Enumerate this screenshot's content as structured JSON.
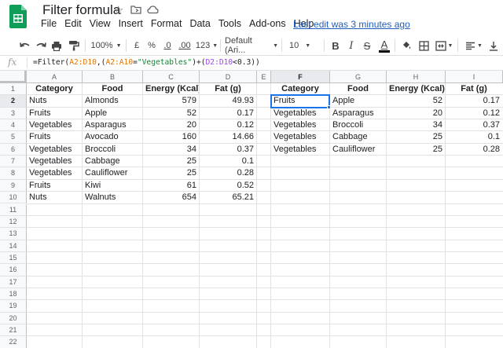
{
  "title": "Filter formula",
  "menu": [
    "File",
    "Edit",
    "View",
    "Insert",
    "Format",
    "Data",
    "Tools",
    "Add-ons",
    "Help"
  ],
  "last_edit": "Last edit was 3 minutes ago",
  "toolbar": {
    "zoom": "100%",
    "currency": "£",
    "percent": "%",
    "dec_less": ".0",
    "dec_more": ".00",
    "more_formats": "123",
    "font": "Default (Ari...",
    "font_size": "10",
    "bold": "B",
    "italic": "I",
    "strike": "S",
    "text_color": "A"
  },
  "formula_bar": {
    "fx": "fx",
    "parts": [
      {
        "text": "=Filter(",
        "cls": ""
      },
      {
        "text": "A2:D10",
        "cls": "f-ref1"
      },
      {
        "text": ",(",
        "cls": ""
      },
      {
        "text": "A2:A10",
        "cls": "f-ref1"
      },
      {
        "text": "=",
        "cls": ""
      },
      {
        "text": "\"Vegetables\"",
        "cls": "f-str"
      },
      {
        "text": ")+(",
        "cls": ""
      },
      {
        "text": "D2:D10",
        "cls": "f-ref2"
      },
      {
        "text": "<0.3))",
        "cls": ""
      }
    ]
  },
  "grid": {
    "columns": [
      "A",
      "B",
      "C",
      "D",
      "E",
      "F",
      "G",
      "H",
      "I"
    ],
    "rows": [
      "1",
      "2",
      "3",
      "4",
      "5",
      "6",
      "7",
      "8",
      "9",
      "10",
      "11",
      "12",
      "13",
      "14",
      "15",
      "16",
      "17",
      "18",
      "19",
      "20",
      "21",
      "22"
    ],
    "selected_cell": "F2",
    "left_table": {
      "headers": [
        "Category",
        "Food",
        "Energy (Kcal)",
        "Fat (g)"
      ],
      "rows": [
        [
          "Nuts",
          "Almonds",
          "579",
          "49.93"
        ],
        [
          "Fruits",
          "Apple",
          "52",
          "0.17"
        ],
        [
          "Vegetables",
          "Asparagus",
          "20",
          "0.12"
        ],
        [
          "Fruits",
          "Avocado",
          "160",
          "14.66"
        ],
        [
          "Vegetables",
          "Broccoli",
          "34",
          "0.37"
        ],
        [
          "Vegetables",
          "Cabbage",
          "25",
          "0.1"
        ],
        [
          "Vegetables",
          "Cauliflower",
          "25",
          "0.28"
        ],
        [
          "Fruits",
          "Kiwi",
          "61",
          "0.52"
        ],
        [
          "Nuts",
          "Walnuts",
          "654",
          "65.21"
        ]
      ]
    },
    "right_table": {
      "headers": [
        "Category",
        "Food",
        "Energy (Kcal)",
        "Fat (g)"
      ],
      "rows": [
        [
          "Fruits",
          "Apple",
          "52",
          "0.17"
        ],
        [
          "Vegetables",
          "Asparagus",
          "20",
          "0.12"
        ],
        [
          "Vegetables",
          "Broccoli",
          "34",
          "0.37"
        ],
        [
          "Vegetables",
          "Cabbage",
          "25",
          "0.1"
        ],
        [
          "Vegetables",
          "Cauliflower",
          "25",
          "0.28"
        ]
      ]
    }
  }
}
